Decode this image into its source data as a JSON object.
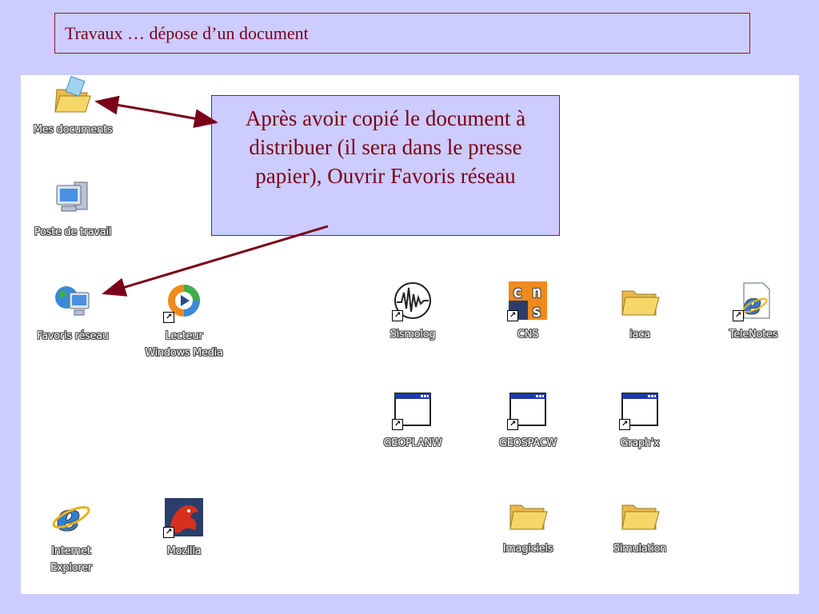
{
  "slide": {
    "title": "Travaux … dépose d’un document",
    "callout": "Après avoir copié le document à distribuer (il sera dans le presse papier), Ouvrir Favoris réseau"
  },
  "desktop": {
    "icons": {
      "mes_documents": "Mes documents",
      "poste_de_travail": "Poste de travail",
      "favoris_reseau": "Favoris réseau",
      "lecteur_line1": "Lecteur",
      "lecteur_line2": "Windows Media",
      "internet_explorer_line1": "Internet",
      "internet_explorer_line2": "Explorer",
      "mozilla": "Mozilla",
      "sismolog": "Sismolog",
      "cns": "CNS",
      "iaca": "iaca",
      "telenotes": "TeleNotes",
      "geoplanw": "GEOPLANW",
      "geospacw": "GEOSPACW",
      "graphx": "Graph'x",
      "imagiciels": "Imagiciels",
      "simulation": "Simulation"
    }
  },
  "colors": {
    "background": "#ccccff",
    "accent": "#7a0019",
    "folder": "#f5d768"
  }
}
